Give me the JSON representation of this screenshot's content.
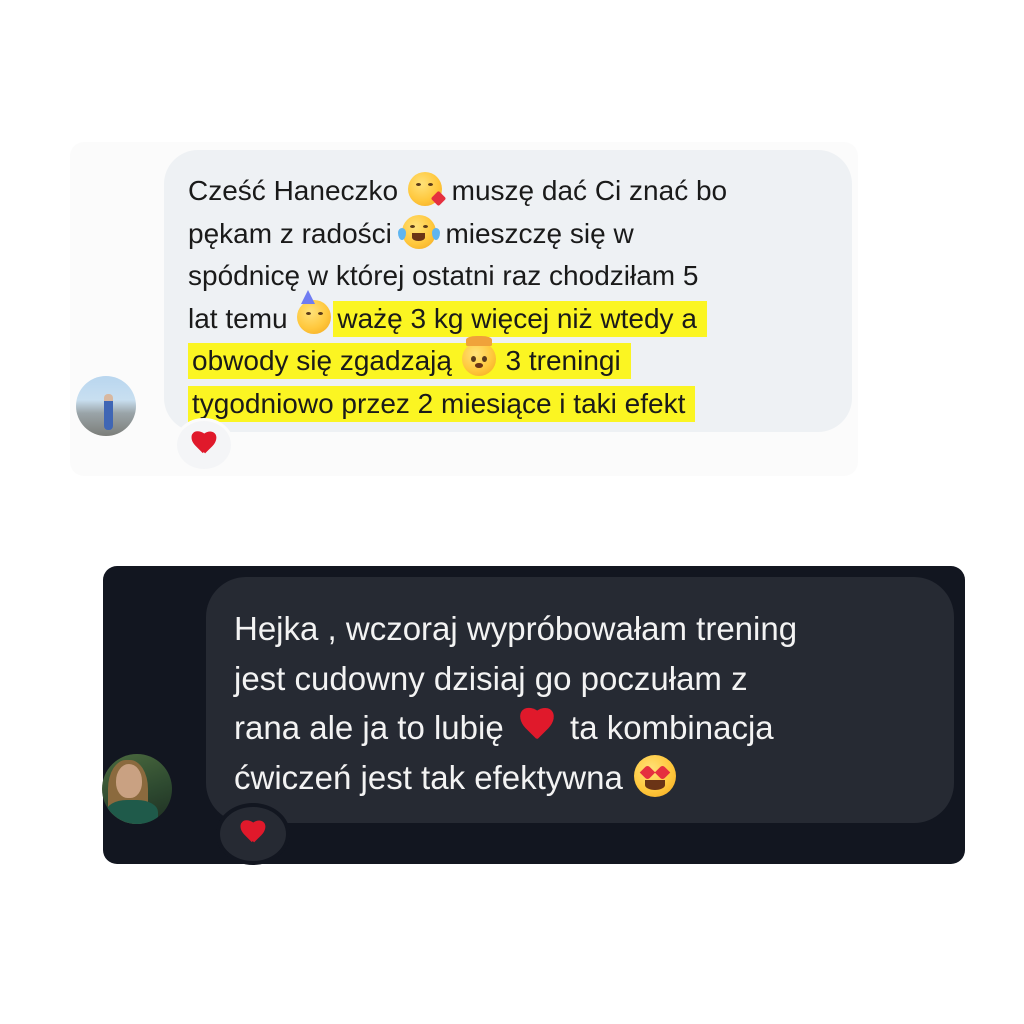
{
  "message_1": {
    "line_1a": "Cześć Haneczko",
    "line_1b": "muszę dać Ci znać bo",
    "line_2a": "pękam z radości",
    "line_2b": "mieszczę się w",
    "line_3": "spódnicę w której ostatni raz  chodziłam 5",
    "line_4a": "lat temu",
    "line_4b": "ważę 3 kg więcej niż wtedy a",
    "line_5a": "obwody się zgadzają",
    "line_5b": "3 treningi",
    "line_6": "tygodniowo przez 2 miesiące i taki efekt",
    "highlight_color": "#fbf522",
    "reaction": "red-heart"
  },
  "message_2": {
    "line_1": "Hejka , wczoraj wypróbowałam trening",
    "line_2": "jest cudowny dzisiaj go poczułam z",
    "line_3a": "rana ale ja to lubię",
    "line_3b": "ta kombinacja",
    "line_4": "ćwiczeń jest tak efektywna",
    "reaction": "red-heart"
  }
}
